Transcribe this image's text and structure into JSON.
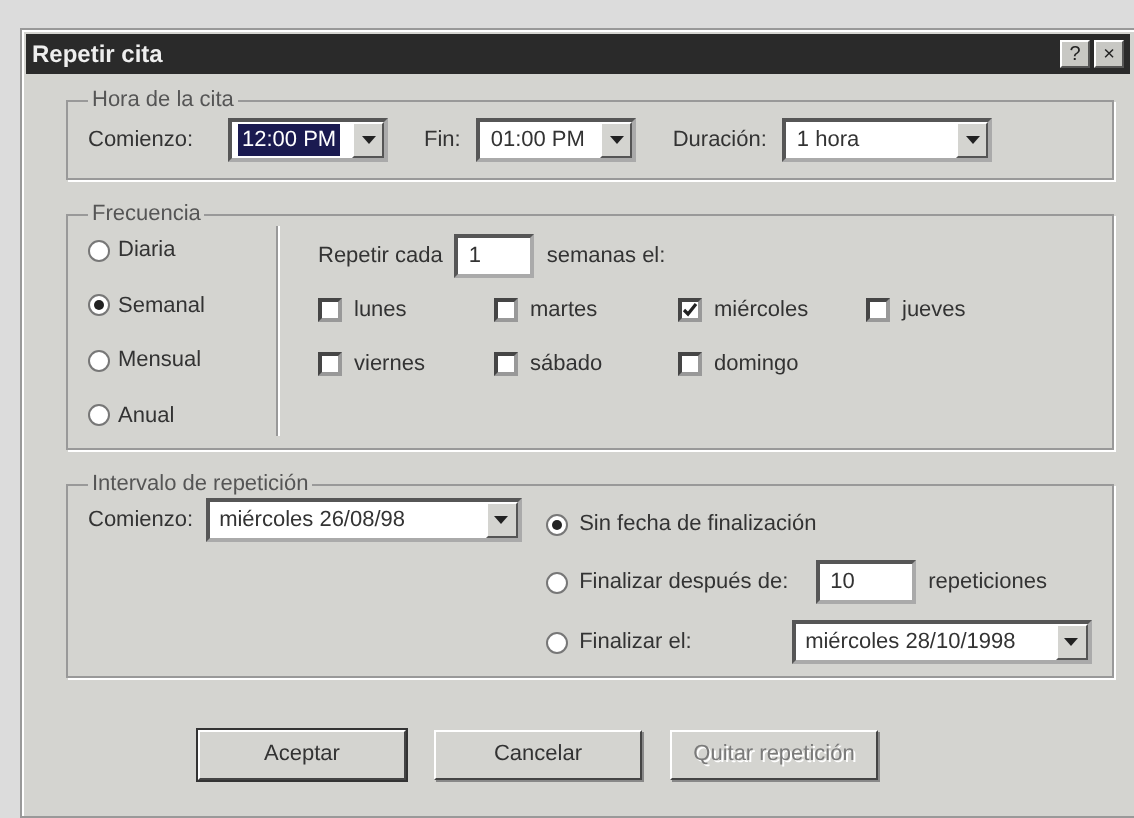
{
  "window": {
    "title": "Repetir cita",
    "title_buttons": [
      "?",
      "×"
    ]
  },
  "appointment_time": {
    "label": "Hora de la cita",
    "fields": [
      {
        "label": "Comienzo:",
        "value": "12:00 PM",
        "selected": true
      },
      {
        "label": "Fin:",
        "value": "01:00 PM",
        "selected": false
      },
      {
        "label": "Duración:",
        "value": "1 hora",
        "selected": false
      }
    ]
  },
  "frequency": {
    "label": "Frecuencia",
    "options": [
      {
        "label": "Diaria",
        "selected": false
      },
      {
        "label": "Semanal",
        "selected": true
      },
      {
        "label": "Mensual",
        "selected": false
      },
      {
        "label": "Anual",
        "selected": false
      }
    ],
    "repeat_label": "Repetir cada",
    "repeat_value": "1",
    "repeat_unit": "semanas el:",
    "days": [
      {
        "label": "lunes",
        "checked": false
      },
      {
        "label": "martes",
        "checked": false
      },
      {
        "label": "miércoles",
        "checked": true
      },
      {
        "label": "jueves",
        "checked": false
      },
      {
        "label": "viernes",
        "checked": false
      },
      {
        "label": "sábado",
        "checked": false
      },
      {
        "label": "domingo",
        "checked": false
      }
    ]
  },
  "range": {
    "label": "Intervalo de repetición",
    "start_label": "Comienzo:",
    "start_value": "miércoles 26/08/98",
    "end_options": [
      {
        "kind": "plain",
        "label": "Sin fecha de finalización",
        "selected": true
      },
      {
        "kind": "count",
        "label": "Finalizar después de:",
        "value": "10",
        "suffix": "repeticiones",
        "selected": false
      },
      {
        "kind": "date",
        "label": "Finalizar el:",
        "value": "miércoles 28/10/1998",
        "selected": false
      }
    ]
  },
  "buttons": [
    {
      "label": "Aceptar",
      "disabled": false
    },
    {
      "label": "Cancelar",
      "disabled": false
    },
    {
      "label": "Quitar repetición",
      "disabled": true
    }
  ]
}
